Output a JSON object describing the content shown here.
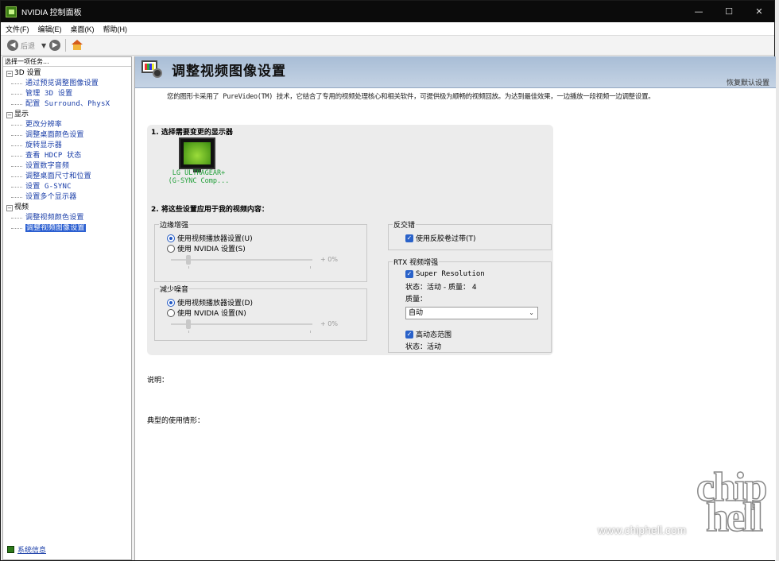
{
  "window": {
    "title": "NVIDIA 控制面板",
    "controls": {
      "minimize": "—",
      "maximize": "☐",
      "close": "✕"
    }
  },
  "menu": [
    "文件(F)",
    "编辑(E)",
    "桌面(K)",
    "帮助(H)"
  ],
  "toolbar": {
    "back_label": "后退"
  },
  "left": {
    "header": "选择一项任务...",
    "categories": [
      {
        "label": "3D 设置",
        "items": [
          "通过预览调整图像设置",
          "管理 3D 设置",
          "配置 Surround、PhysX"
        ]
      },
      {
        "label": "显示",
        "items": [
          "更改分辨率",
          "调整桌面颜色设置",
          "旋转显示器",
          "查看 HDCP 状态",
          "设置数字音频",
          "调整桌面尺寸和位置",
          "设置 G-SYNC",
          "设置多个显示器"
        ]
      },
      {
        "label": "视频",
        "items": [
          "调整视频颜色设置",
          "调整视频图像设置"
        ]
      }
    ],
    "system_info": "系统信息"
  },
  "main": {
    "title": "调整视频图像设置",
    "restore_defaults": "恢复默认设置",
    "intro": "您的图形卡采用了 PureVideo(TM) 技术，它结合了专用的视频处理核心和相关软件，可提供极为顺畅的视频回放。为达到最佳效果，一边播放一段视频一边调整设置。",
    "section1": "1. 选择需要变更的显示器",
    "display_name": "LG ULTRAGEAR+",
    "display_sub": "(G-SYNC Comp...",
    "section2": "2. 将这些设置应用于我的视频内容：",
    "edge": {
      "legend": "边缘增强",
      "opt1": "使用视频播放器设置(U)",
      "opt2": "使用 NVIDIA 设置(S)",
      "slider_value": "+ 0%",
      "level": 0
    },
    "noise": {
      "legend": "减少噪音",
      "opt1": "使用视频播放器设置(D)",
      "opt2": "使用 NVIDIA 设置(N)",
      "slider_value": "+ 0%",
      "level": 0
    },
    "deinterlace": {
      "legend": "反交错",
      "check": "使用反胶卷过带(T)"
    },
    "rtx": {
      "legend": "RTX 视频增强",
      "sr_label": "Super Resolution",
      "sr_status": "状态：活动 - 质量： 4",
      "quality_label": "质量：",
      "quality_value": "自动",
      "hdr_label": "高动态范围",
      "hdr_status": "状态：活动"
    },
    "desc_label": "说明：",
    "usage_label": "典型的使用情形："
  },
  "watermark": {
    "url": "www.chiphell.com",
    "logo_top": "chip",
    "logo_bottom": "hell"
  },
  "colors": {
    "accent": "#2a62c9",
    "display_label": "#23a03a",
    "link": "#1a3ea8",
    "header_band": "#b4c6dc"
  }
}
